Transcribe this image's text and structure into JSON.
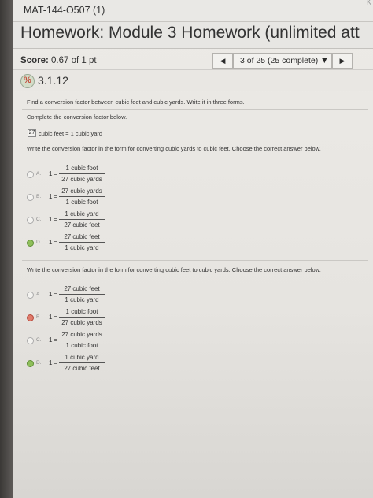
{
  "browser": {
    "tab_title": "MAT-144-O507 (1)",
    "corner_text": "K"
  },
  "header": {
    "title": "Homework: Module 3 Homework (unlimited att"
  },
  "score": {
    "label": "Score:",
    "value": "0.67 of 1 pt"
  },
  "nav": {
    "prev_icon": "triangle-left-icon",
    "position_text": "3 of 25 (25 complete) ▼",
    "next_icon": "triangle-right-icon"
  },
  "question": {
    "number": "3.1.12",
    "instruction": "Find a conversion factor between cubic feet and cubic yards. Write it in three forms.",
    "prompt": "Complete the conversion factor below.",
    "given_value": "27",
    "given_text": "cubic feet = 1 cubic yard",
    "part1_prompt": "Write the conversion factor in the form for converting cubic yards to cubic feet. Choose the correct answer below.",
    "part1_options": [
      {
        "letter": "A.",
        "one": "1 =",
        "numerator": "1 cubic foot",
        "denominator": "27 cubic yards",
        "state": "none"
      },
      {
        "letter": "B.",
        "one": "1 =",
        "numerator": "27 cubic yards",
        "denominator": "1 cubic foot",
        "state": "none"
      },
      {
        "letter": "C.",
        "one": "1 =",
        "numerator": "1 cubic yard",
        "denominator": "27 cubic feet",
        "state": "none"
      },
      {
        "letter": "D.",
        "one": "1 =",
        "numerator": "27 cubic feet",
        "denominator": "1 cubic yard",
        "state": "correct"
      }
    ],
    "part2_prompt": "Write the conversion factor in the form for converting cubic feet to cubic yards. Choose the correct answer below.",
    "part2_options": [
      {
        "letter": "A.",
        "one": "1 =",
        "numerator": "27 cubic feet",
        "denominator": "1 cubic yard",
        "state": "none"
      },
      {
        "letter": "B.",
        "one": "1 =",
        "numerator": "1 cubic foot",
        "denominator": "27 cubic yards",
        "state": "wrong"
      },
      {
        "letter": "C.",
        "one": "1 =",
        "numerator": "27 cubic yards",
        "denominator": "1 cubic foot",
        "state": "none"
      },
      {
        "letter": "D.",
        "one": "1 =",
        "numerator": "1 cubic yard",
        "denominator": "27 cubic feet",
        "state": "correct"
      }
    ]
  }
}
